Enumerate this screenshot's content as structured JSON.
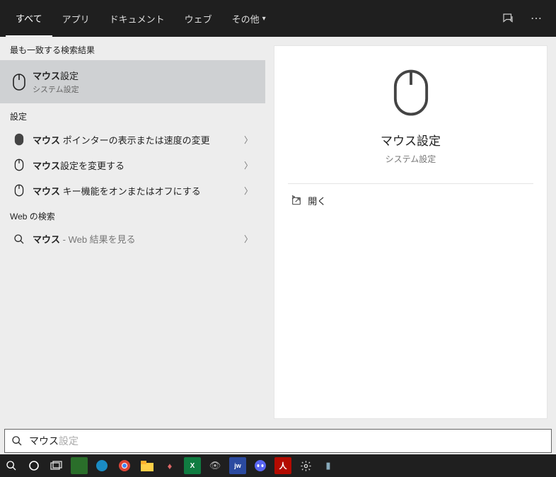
{
  "tabs": {
    "all": "すべて",
    "apps": "アプリ",
    "docs": "ドキュメント",
    "web": "ウェブ",
    "more": "その他"
  },
  "sections": {
    "best": "最も一致する検索結果",
    "settings": "設定",
    "web": "Web の検索"
  },
  "best_match": {
    "title_bold": "マウス",
    "title_rest": "設定",
    "subtitle": "システム設定"
  },
  "settings_items": [
    {
      "bold": "マウス",
      "rest": " ポインターの表示または速度の変更"
    },
    {
      "bold": "マウス",
      "rest": "設定を変更する"
    },
    {
      "bold": "マウス",
      "rest": " キー機能をオンまたはオフにする"
    }
  ],
  "web_items": [
    {
      "bold": "マウス",
      "rest": " - Web 結果を見る"
    }
  ],
  "preview": {
    "title": "マウス設定",
    "subtitle": "システム設定",
    "open": "開く"
  },
  "search": {
    "value": "マウス",
    "placeholder": "設定"
  }
}
